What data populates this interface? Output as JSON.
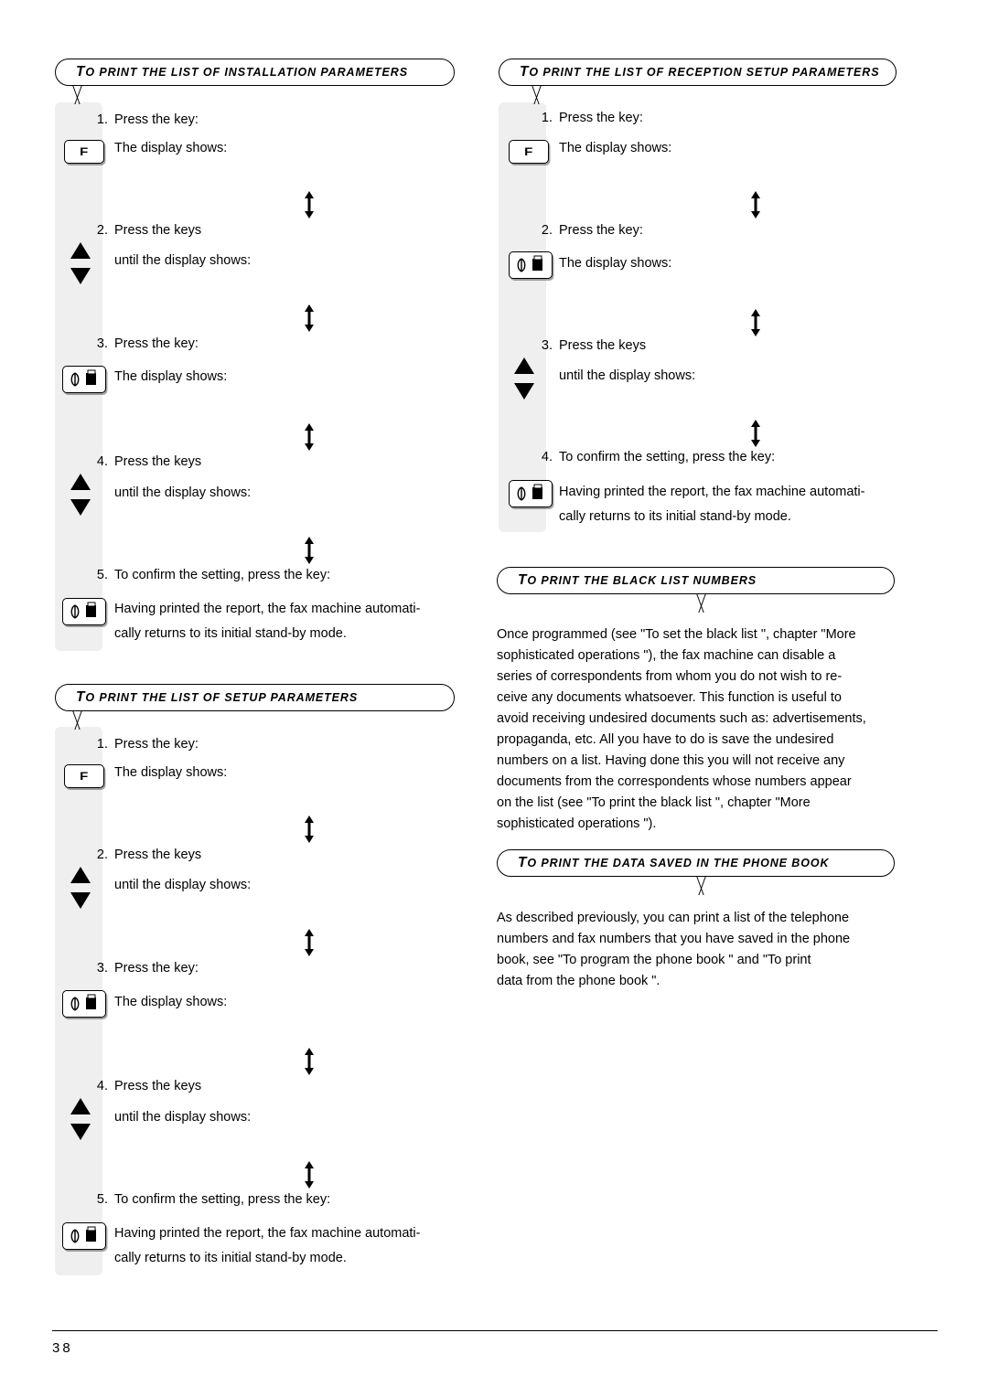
{
  "page": {
    "number": "38"
  },
  "sections": {
    "installation_parameters": {
      "title_first_letter": "T",
      "title_rest": "O PRINT THE LIST OF INSTALLATION  PARAMETERS",
      "steps": [
        {
          "num": "1.",
          "line1": "Press the key:",
          "line2": "The display shows:"
        },
        {
          "num": "2.",
          "line1": "Press the keys",
          "line2": "until the display shows:"
        },
        {
          "num": "3.",
          "line1": "Press the key:",
          "line2": "The display shows:"
        },
        {
          "num": "4.",
          "line1": "Press the keys",
          "line2": "until the display shows:"
        },
        {
          "num": "5.",
          "line1": "To confirm the setting, press the key:",
          "line2": "Having printed the report, the fax machine automati-",
          "line3": "cally returns to its initial stand-by mode."
        }
      ]
    },
    "setup_parameters": {
      "title_first_letter": "T",
      "title_rest": "O PRINT THE LIST OF SETUP PARAMETERS",
      "steps": [
        {
          "num": "1.",
          "line1": "Press the key:",
          "line2": "The display shows:"
        },
        {
          "num": "2.",
          "line1": "Press the keys",
          "line2": "until the display shows:"
        },
        {
          "num": "3.",
          "line1": "Press the key:",
          "line2": "The display shows:"
        },
        {
          "num": "4.",
          "line1": "Press the keys",
          "line2": "until the display shows:"
        },
        {
          "num": "5.",
          "line1": "To confirm the setting, press the key:",
          "line2": "Having printed the report, the fax machine automati-",
          "line3": "cally returns to its initial stand-by mode."
        }
      ]
    },
    "reception_setup_parameters": {
      "title_first_letter": "T",
      "title_rest": "O PRINT THE LIST OF RECEPTION SETUP PARAMETERS",
      "steps": [
        {
          "num": "1.",
          "line1": "Press the key:",
          "line2": "The display shows:"
        },
        {
          "num": "2.",
          "line1": "Press the key:",
          "line2": "The display shows:"
        },
        {
          "num": "3.",
          "line1": "Press the keys",
          "line2": "until the display shows:"
        },
        {
          "num": "4.",
          "line1": "To confirm the setting, press the key:",
          "line2": "Having printed the report, the fax machine automati-",
          "line3": "cally returns to its initial stand-by mode."
        }
      ]
    },
    "black_list_numbers": {
      "title_first_letter": "T",
      "title_rest": "O PRINT THE BLACK  LIST  NUMBERS",
      "body_lines": [
        "Once programmed (see \"To set the black list  \", chapter \"More",
        "sophisticated operations   \"), the fax machine can disable a",
        "series of correspondents from whom you do not wish to re-",
        "ceive any documents whatsoever. This function is useful to",
        "avoid receiving undesired documents such as: advertisements,",
        "propaganda, etc. All you have to do is save the undesired",
        "numbers on a list. Having done this you will not receive any",
        "documents from the correspondents whose numbers appear",
        "on the list (see \"To print the black list \", chapter \"More",
        "sophisticated  operations   \")."
      ]
    },
    "phone_book_data": {
      "title_first_letter": "T",
      "title_rest": "O PRINT THE DATA SAVED IN THE PHONE BOOK",
      "body_lines": [
        "As described previously, you can print a list of the telephone",
        "numbers and fax numbers that you have saved in the phone",
        "book, see \"To program the phone book  \" and \"To print",
        "data  from  the  phone  book  \"."
      ]
    }
  },
  "icons": {
    "f_key_label": "F",
    "start_key": "start-copy-key",
    "updown_key": "up-down-arrow-key",
    "flow_marker": "flow-double-arrow"
  }
}
